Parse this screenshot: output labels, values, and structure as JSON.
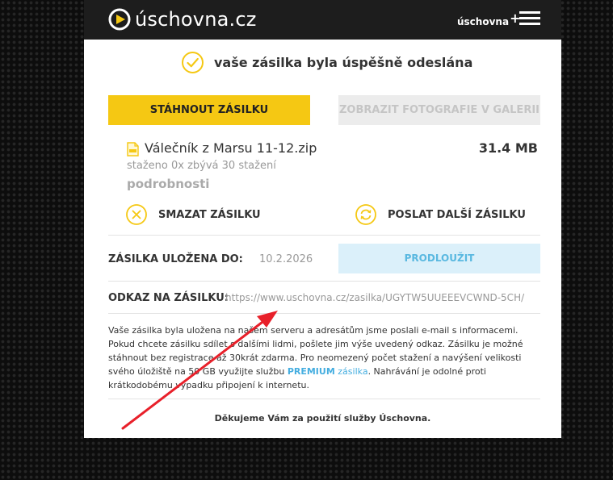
{
  "header": {
    "brand": "úschovna.cz",
    "plus_label": "úschovna",
    "plus_sign": "+",
    "menu_icon": "hamburger-icon"
  },
  "status": {
    "message": "vaše zásilka byla úspěšně odeslána",
    "icon": "check-circle-icon"
  },
  "buttons": {
    "download": "STÁHNOUT ZÁSILKU",
    "gallery": "ZOBRAZIT FOTOGRAFIE V GALERII"
  },
  "file": {
    "icon": "zip-file-icon",
    "name": "Válečník z Marsu 11-12.zip",
    "size": "31.4 MB",
    "stats": "staženo 0x zbývá 30 stažení",
    "details": "podrobnosti"
  },
  "actions": {
    "delete": "SMAZAT ZÁSILKU",
    "send_another": "POSLAT DALŠÍ ZÁSILKU"
  },
  "storage": {
    "label": "ZÁSILKA ULOŽENA DO:",
    "date": "10.2.2026",
    "extend": "PRODLOUŽIT"
  },
  "link": {
    "label": "ODKAZ NA ZÁSILKU:",
    "url": "https://www.uschovna.cz/zasilka/UGYTW5UUEEEVCWND-5CH/"
  },
  "info": {
    "text_before": "Vaše zásilka byla uložena na našem serveru a adresátům jsme poslali e-mail s informacemi. Pokud chcete zásilku sdílet s dalšími lidmi, pošlete jim výše uvedený odkaz. Zásilku je možné stáhnout bez registrace až 30krát zdarma. Pro neomezený počet stažení a navýšení velikosti svého úložiště na 50 GB využijte službu ",
    "premium": "PREMIUM",
    "zasilka": "zásilka",
    "text_after": ". Nahrávání je odolné proti krátkodobému výpadku připojení k internetu."
  },
  "footer": {
    "thanks": "Děkujeme Vám za použití služby Úschovna."
  },
  "colors": {
    "accent_yellow": "#f5c813",
    "topbar": "#1d1d1d",
    "extend_bg": "#dbf0fa",
    "extend_text": "#59b8e0",
    "annotation_arrow": "#e8202a"
  },
  "annotation": "red-arrow-pointing-to-link"
}
